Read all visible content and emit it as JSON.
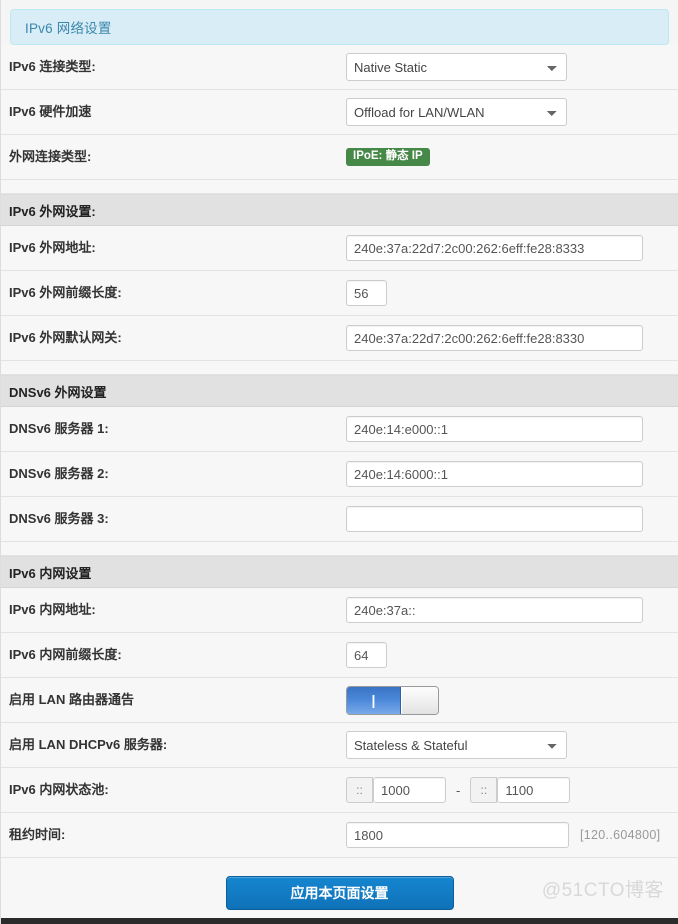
{
  "header": {
    "title": "IPv6 网络设置"
  },
  "rows": {
    "conn_type_label": "IPv6 连接类型:",
    "conn_type_value": "Native Static",
    "hw_accel_label": "IPv6 硬件加速",
    "hw_accel_value": "Offload for LAN/WLAN",
    "wan_conn_type_label": "外网连接类型:",
    "wan_conn_type_badge": "IPoE: 静态 IP"
  },
  "wan_section": {
    "heading": "IPv6 外网设置:",
    "address_label": "IPv6 外网地址:",
    "address_value": "240e:37a:22d7:2c00:262:6eff:fe28:8333",
    "prefix_label": "IPv6 外网前缀长度:",
    "prefix_value": "56",
    "gateway_label": "IPv6 外网默认网关:",
    "gateway_value": "240e:37a:22d7:2c00:262:6eff:fe28:8330"
  },
  "dns_section": {
    "heading": "DNSv6 外网设置",
    "server1_label": "DNSv6 服务器 1:",
    "server1_value": "240e:14:e000::1",
    "server2_label": "DNSv6 服务器 2:",
    "server2_value": "240e:14:6000::1",
    "server3_label": "DNSv6 服务器 3:",
    "server3_value": ""
  },
  "lan_section": {
    "heading": "IPv6 内网设置",
    "address_label": "IPv6 内网地址:",
    "address_value": "240e:37a::",
    "prefix_label": "IPv6 内网前缀长度:",
    "prefix_value": "64",
    "ra_label": "启用 LAN 路由器通告",
    "ra_state": "|",
    "dhcpv6_label": "启用 LAN DHCPv6 服务器:",
    "dhcpv6_value": "Stateless & Stateful",
    "pool_label": "IPv6 内网状态池:",
    "pool_prefix": "::",
    "pool_start": "1000",
    "pool_separator": "-",
    "pool_end": "1100",
    "lease_label": "租约时间:",
    "lease_value": "1800",
    "lease_hint": "[120..604800]"
  },
  "footer": {
    "apply_label": "应用本页面设置"
  },
  "watermark": {
    "text": "@51CTO博客"
  },
  "options": {
    "conn_type": [
      "Native Static"
    ],
    "hw_accel": [
      "Offload for LAN/WLAN"
    ],
    "dhcpv6": [
      "Stateless & Stateful"
    ]
  },
  "colors": {
    "header_bg": "#d9edf7",
    "header_text": "#3a87ad",
    "badge_green": "#468847",
    "apply_blue": "#0f72b8",
    "toggle_blue": "#4a87d8"
  }
}
